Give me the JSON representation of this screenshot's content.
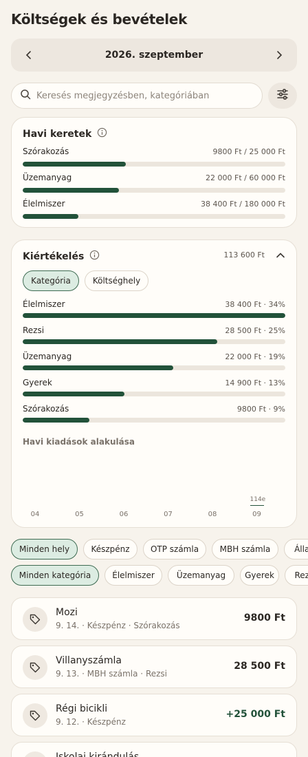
{
  "header": {
    "title": "Költségek és bevételek"
  },
  "month_nav": {
    "label": "2026. szeptember",
    "prev_icon": "chevron-left-icon",
    "next_icon": "chevron-right-icon"
  },
  "search": {
    "placeholder": "Keresés megjegyzésben, kategóriában",
    "value": ""
  },
  "budgets": {
    "title": "Havi keretek",
    "items": [
      {
        "label": "Szórakozás",
        "value": "9800 Ft / 25 000 Ft",
        "fraction": 0.392
      },
      {
        "label": "Üzemanyag",
        "value": "22 000 Ft / 60 000 Ft",
        "fraction": 0.367
      },
      {
        "label": "Élelmiszer",
        "value": "38 400 Ft / 180 000 Ft",
        "fraction": 0.213
      }
    ]
  },
  "evaluation": {
    "title": "Kiértékelés",
    "total": "113 600 Ft",
    "tabs": [
      {
        "label": "Kategória",
        "active": true
      },
      {
        "label": "Költséghely",
        "active": false
      }
    ],
    "items": [
      {
        "label": "Élelmiszer",
        "value": "38 400 Ft · 34%",
        "fraction": 1.0
      },
      {
        "label": "Rezsi",
        "value": "28 500 Ft · 25%",
        "fraction": 0.742
      },
      {
        "label": "Üzemanyag",
        "value": "22 000 Ft · 19%",
        "fraction": 0.573
      },
      {
        "label": "Gyerek",
        "value": "14 900 Ft · 13%",
        "fraction": 0.388
      },
      {
        "label": "Szórakozás",
        "value": "9800 Ft · 9%",
        "fraction": 0.255
      }
    ],
    "chart_title": "Havi kiadások alakulása"
  },
  "chart_data": {
    "type": "bar",
    "categories": [
      "04",
      "05",
      "06",
      "07",
      "08",
      "09"
    ],
    "values": [
      0,
      0,
      0,
      0,
      0,
      114
    ],
    "value_labels": [
      "",
      "",
      "",
      "",
      "",
      "114e"
    ],
    "title": "Havi kiadások alakulása",
    "xlabel": "",
    "ylabel": ""
  },
  "place_filters": [
    "Minden hely",
    "Készpénz",
    "OTP számla",
    "MBH számla",
    "Állan"
  ],
  "category_filters": [
    "Minden kategória",
    "Élelmiszer",
    "Üzemanyag",
    "Gyerek",
    "Rezsi"
  ],
  "transactions": [
    {
      "title": "Mozi",
      "subtitle": "9. 14. · Készpénz · Szórakozás",
      "amount": "9800 Ft",
      "income": false
    },
    {
      "title": "Villanyszámla",
      "subtitle": "9. 13. · MBH számla · Rezsi",
      "amount": "28 500 Ft",
      "income": false
    },
    {
      "title": "Régi bicikli",
      "subtitle": "9. 12. · Készpénz",
      "amount": "+25 000 Ft",
      "income": true
    },
    {
      "title": "Iskolai kirándulás",
      "subtitle": "",
      "amount": "",
      "income": false
    }
  ],
  "colors": {
    "accent": "#22523a",
    "track": "#ece6dd",
    "background": "#f7f3ec",
    "card": "#fffdf9",
    "active_chip": "#dcece2"
  }
}
